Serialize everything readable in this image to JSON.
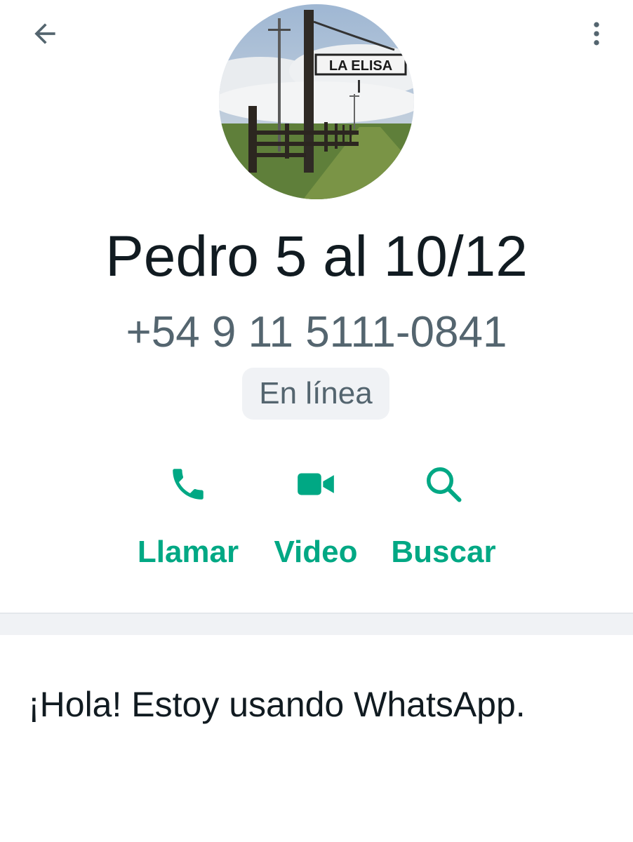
{
  "header": {
    "back_icon": "arrow-left-icon",
    "menu_icon": "more-vertical-icon"
  },
  "profile": {
    "avatar_sign_text": "LA ELISA",
    "name": "Pedro 5 al 10/12",
    "phone": "+54 9 11 5111-0841",
    "status": "En línea"
  },
  "actions": [
    {
      "label": "Llamar",
      "icon": "phone-icon"
    },
    {
      "label": "Video",
      "icon": "video-camera-icon"
    },
    {
      "label": "Buscar",
      "icon": "search-icon"
    }
  ],
  "about": {
    "text": "¡Hola! Estoy usando WhatsApp."
  },
  "colors": {
    "accent": "#00a884",
    "primary_text": "#111b21",
    "secondary_text": "#54656f",
    "divider": "#f0f2f5"
  }
}
